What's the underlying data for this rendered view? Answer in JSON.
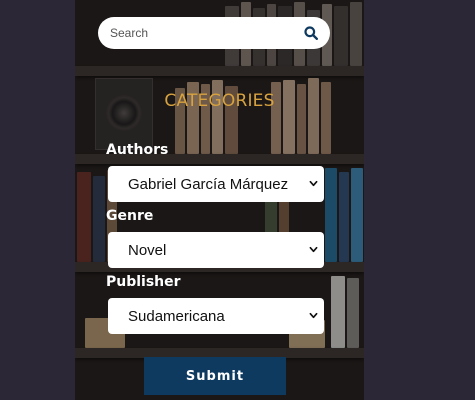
{
  "search": {
    "placeholder": "Search",
    "value": ""
  },
  "filters": {
    "heading": "CATEGORIES",
    "authors": {
      "label": "Authors",
      "selected": "Gabriel García Márquez"
    },
    "genre": {
      "label": "Genre",
      "selected": "Novel"
    },
    "publisher": {
      "label": "Publisher",
      "selected": "Sudamericana"
    }
  },
  "submit_label": "Submit",
  "colors": {
    "page_background": "#2b2737",
    "heading": "#d7a23f",
    "submit_button": "#0f3a60",
    "search_icon": "#0f3a60"
  },
  "icons": {
    "search": "search-icon",
    "dropdown": "chevron-down-icon"
  }
}
